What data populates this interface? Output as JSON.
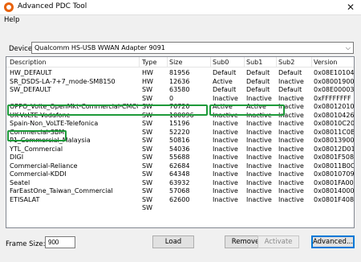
{
  "window": {
    "title": "Advanced PDC Tool",
    "close_glyph": "✕"
  },
  "menu": {
    "help": "Help"
  },
  "device": {
    "label": "Device:",
    "value": "Qualcomm HS-USB WWAN Adapter 9091"
  },
  "table": {
    "columns": [
      "Description",
      "Type",
      "Size",
      "Sub0",
      "Sub1",
      "Sub2",
      "Version"
    ],
    "rows": [
      [
        "HW_DEFAULT",
        "HW",
        "81956",
        "Default",
        "Default",
        "Default",
        "0x08E10104"
      ],
      [
        "SR_DSDS-LA-7+7_mode-SM8150",
        "HW",
        "12636",
        "Active",
        "Default",
        "Inactive",
        "0x08001900"
      ],
      [
        "SW_DEFAULT",
        "SW",
        "63580",
        "Default",
        "Default",
        "Default",
        "0x08E00003"
      ],
      [
        "",
        "SW",
        "0",
        "Inactive",
        "Inactive",
        "Inactive",
        "0xFFFFFFFF"
      ],
      [
        "OPPO_Volte_OpenMkt-Commercial-CMCC",
        "SW",
        "76720",
        "Active",
        "Active",
        "Inactive",
        "0x08012010"
      ],
      [
        "UK-VoLTE-Vodafone",
        "SW",
        "100096",
        "Inactive",
        "Inactive",
        "Inactive",
        "0x08010426"
      ],
      [
        "Spain-Non_VoLTE-Telefonica",
        "SW",
        "15196",
        "Inactive",
        "Inactive",
        "Inactive",
        "0x08010C20"
      ],
      [
        "Commercial-SBM",
        "SW",
        "52220",
        "Inactive",
        "Inactive",
        "Inactive",
        "0x08011C0B"
      ],
      [
        "P1_Commercial_Malaysia",
        "SW",
        "50816",
        "Inactive",
        "Inactive",
        "Inactive",
        "0x08013900"
      ],
      [
        "YTL_Commercial",
        "SW",
        "54036",
        "Inactive",
        "Inactive",
        "Inactive",
        "0x08012D01"
      ],
      [
        "DIGI",
        "SW",
        "55688",
        "Inactive",
        "Inactive",
        "Inactive",
        "0x0801F508"
      ],
      [
        "Commercial-Reliance",
        "SW",
        "62684",
        "Inactive",
        "Inactive",
        "Inactive",
        "0x08011B0C"
      ],
      [
        "Commercial-KDDI",
        "SW",
        "64348",
        "Inactive",
        "Inactive",
        "Inactive",
        "0x08010709"
      ],
      [
        "Seatel",
        "SW",
        "63932",
        "Inactive",
        "Inactive",
        "Inactive",
        "0x0801FA00"
      ],
      [
        "FarEastOne_Taiwan_Commercial",
        "SW",
        "57068",
        "Inactive",
        "Inactive",
        "Inactive",
        "0x08014000"
      ],
      [
        "ETISALAT",
        "SW",
        "62600",
        "Inactive",
        "Inactive",
        "Inactive",
        "0x0801F408"
      ],
      [
        "",
        "SW",
        "",
        "",
        "",
        "",
        ""
      ]
    ],
    "highlighted_rows": [
      4,
      7
    ],
    "highlight_color": "#1e9a3a"
  },
  "footer": {
    "frame_size_label": "Frame Size:",
    "frame_size_value": "900",
    "load": "Load",
    "remove": "Remove",
    "activate": "Activate",
    "advanced": "Advanced..."
  }
}
